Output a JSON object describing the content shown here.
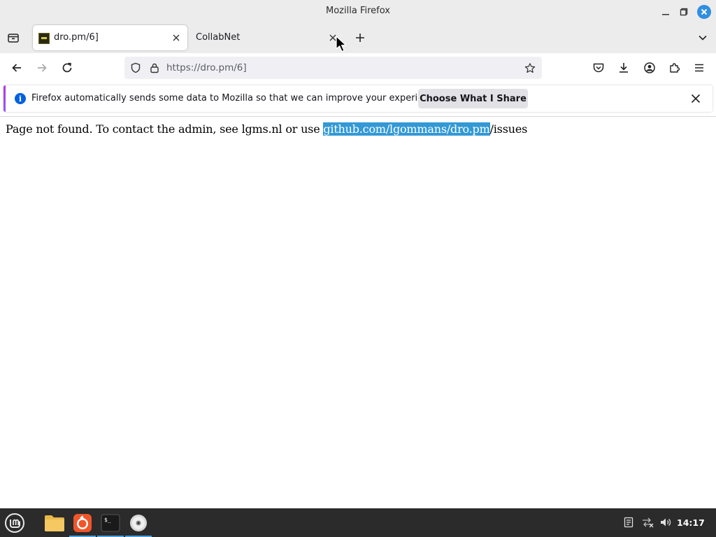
{
  "window": {
    "title": "Mozilla Firefox"
  },
  "tabs": [
    {
      "label": "dro.pm/6]",
      "active": true
    },
    {
      "label": "CollabNet",
      "active": false
    }
  ],
  "navbar": {
    "url": "https://dro.pm/6]"
  },
  "notification": {
    "text": "Firefox automatically sends some data to Mozilla so that we can improve your experience.",
    "button_label": "Choose What I Share"
  },
  "page": {
    "text_before": "Page not found. To contact the admin, see lgms.nl or use ",
    "selected_text": "github.com/lgommans/dro.pm",
    "text_after": "/issues"
  },
  "taskbar": {
    "clock": "14:17",
    "apps": [
      "menu-icon",
      "files-icon",
      "firefox-icon",
      "terminal-icon",
      "disc-icon"
    ],
    "tray": [
      "notes-icon",
      "network-disconnected-icon",
      "volume-icon"
    ]
  },
  "colors": {
    "selection": "#3399d6",
    "close_button": "#2f8fe0",
    "info": "#0060df",
    "taskbar": "#2b2b2b"
  }
}
